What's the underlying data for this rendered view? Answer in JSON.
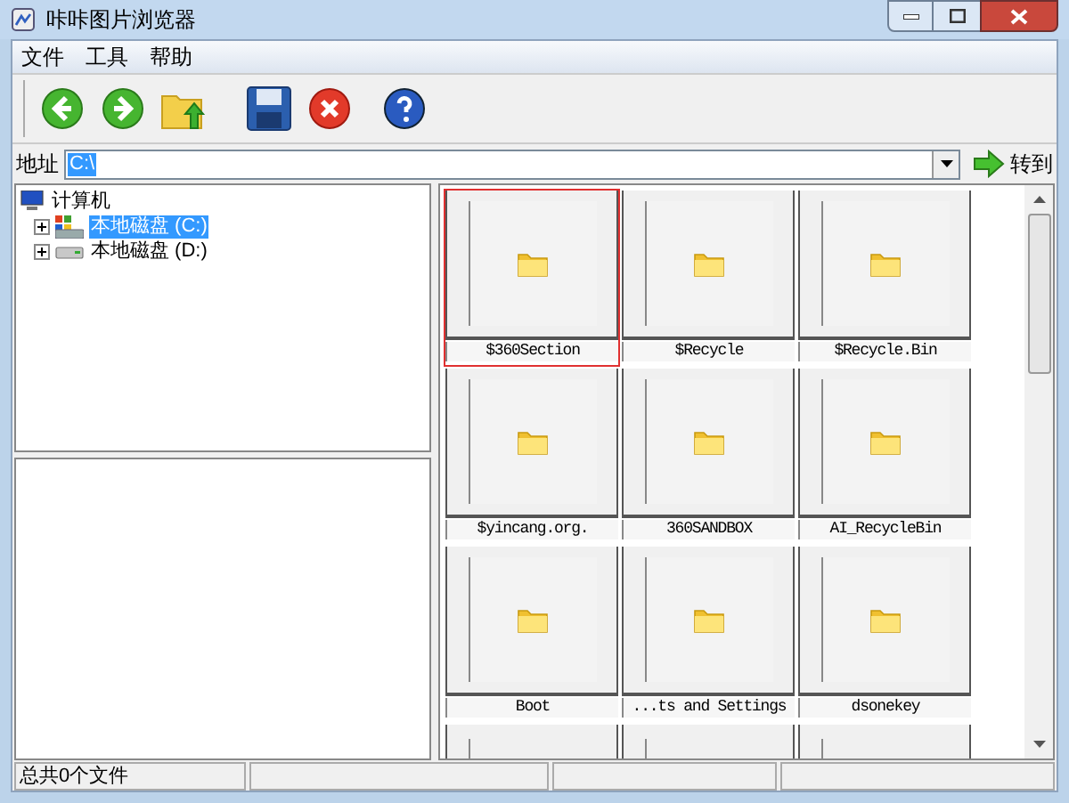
{
  "window": {
    "title": "咔咔图片浏览器"
  },
  "menu": [
    "文件",
    "工具",
    "帮助"
  ],
  "address": {
    "label": "地址",
    "value": "C:\\",
    "go": "转到"
  },
  "tree": [
    {
      "label": "计算机",
      "kind": "computer",
      "selected": false,
      "children": [
        {
          "label": "本地磁盘 (C:)",
          "kind": "system-drive",
          "selected": true
        },
        {
          "label": "本地磁盘 (D:)",
          "kind": "drive",
          "selected": false
        }
      ]
    }
  ],
  "thumbnails": [
    {
      "label": "$360Section",
      "selected": true
    },
    {
      "label": "$Recycle",
      "selected": false
    },
    {
      "label": "$Recycle.Bin",
      "selected": false
    },
    {
      "label": "$yincang.org.",
      "selected": false
    },
    {
      "label": "360SANDBOX",
      "selected": false
    },
    {
      "label": "AI_RecycleBin",
      "selected": false
    },
    {
      "label": "Boot",
      "selected": false
    },
    {
      "label": "...ts and Settings",
      "selected": false
    },
    {
      "label": "dsonekey",
      "selected": false
    }
  ],
  "status_bar": {
    "text": "总共0个文件"
  }
}
